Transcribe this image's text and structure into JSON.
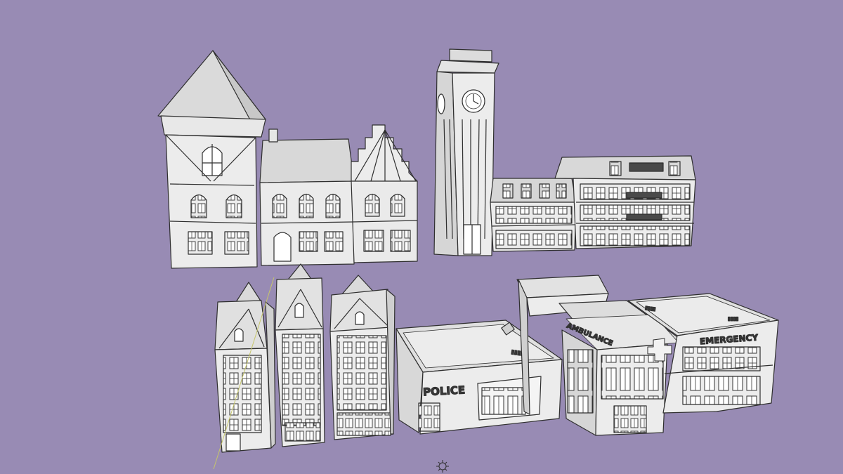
{
  "viewport": {
    "background_color": "#988bb4"
  },
  "colors": {
    "wall": "#e9e9e9",
    "wall_shade": "#d2d2d2",
    "roof": "#dcdcdc",
    "roof_shade": "#c4c4c4",
    "edge": "#2f2f2f",
    "window": "#4a4a4a"
  },
  "signs": {
    "police": "POLICE",
    "ambulance": "AMBULANCE",
    "emergency": "EMERGENCY"
  },
  "icons": {
    "origin": "scene-origin-icon"
  }
}
